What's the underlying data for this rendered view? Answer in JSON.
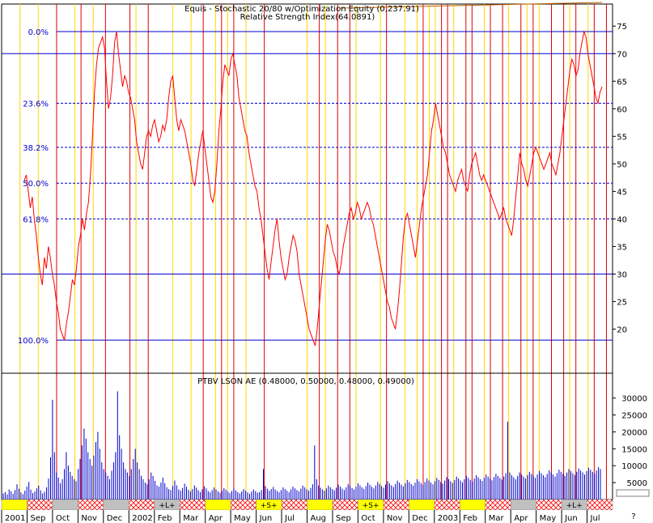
{
  "chart_data": [
    {
      "type": "line",
      "title": "Equis - Stochastic 20/80  w/Optimization Equity (0,237.91)",
      "subtitle": "Relative Strength Index(64.0891)",
      "ylim": [
        12,
        79
      ],
      "yticks": [
        20,
        25,
        30,
        35,
        40,
        45,
        50,
        55,
        60,
        65,
        70,
        75
      ],
      "hlines": [
        {
          "y": 70,
          "style": "solid"
        },
        {
          "y": 30,
          "style": "solid"
        }
      ],
      "fib_levels": [
        {
          "label": "0.0%",
          "y": 74
        },
        {
          "label": "23.6%",
          "y": 61
        },
        {
          "label": "38.2%",
          "y": 53
        },
        {
          "label": "50.0%",
          "y": 46.5
        },
        {
          "label": "61.8%",
          "y": 40
        },
        {
          "label": "100.0%",
          "y": 18
        }
      ],
      "series": [
        {
          "color": "#ff0000",
          "values": [
            47,
            48,
            45,
            42,
            44,
            40,
            37,
            33,
            30,
            28,
            33,
            31,
            35,
            33,
            30,
            28,
            25,
            23,
            20,
            19,
            18,
            21,
            23,
            26,
            29,
            28,
            31,
            35,
            37,
            40,
            38,
            41,
            43,
            48,
            55,
            63,
            68,
            71,
            72,
            73,
            71,
            65,
            60,
            62,
            66,
            72,
            74,
            70,
            67,
            64,
            66,
            65,
            63,
            62,
            60,
            58,
            54,
            52,
            50,
            49,
            52,
            55,
            56,
            55,
            57,
            58,
            56,
            54,
            55,
            57,
            56,
            58,
            62,
            65,
            66,
            62,
            58,
            56,
            58,
            57,
            56,
            54,
            52,
            50,
            47,
            46,
            49,
            52,
            54,
            56,
            53,
            50,
            47,
            44,
            43,
            45,
            50,
            56,
            60,
            65,
            68,
            67,
            66,
            69,
            70,
            68,
            66,
            62,
            60,
            58,
            56,
            55,
            52,
            50,
            48,
            46,
            45,
            42,
            40,
            37,
            34,
            31,
            29,
            32,
            35,
            38,
            40,
            36,
            33,
            31,
            29,
            30,
            33,
            35,
            37,
            36,
            34,
            30,
            28,
            26,
            24,
            22,
            20,
            19,
            18,
            17,
            20,
            24,
            28,
            32,
            36,
            39,
            38,
            36,
            34,
            33,
            31,
            30,
            32,
            35,
            37,
            39,
            41,
            42,
            40,
            41,
            43,
            42,
            40,
            41,
            42,
            43,
            42,
            40,
            39,
            37,
            35,
            33,
            31,
            29,
            27,
            25,
            24,
            22,
            21,
            20,
            23,
            27,
            32,
            37,
            40,
            41,
            39,
            37,
            35,
            33,
            36,
            39,
            42,
            44,
            46,
            48,
            52,
            56,
            58,
            61,
            59,
            57,
            55,
            53,
            52,
            50,
            48,
            47,
            46,
            45,
            47,
            48,
            49,
            47,
            46,
            45,
            48,
            50,
            51,
            52,
            50,
            48,
            47,
            48,
            47,
            46,
            45,
            44,
            43,
            42,
            41,
            40,
            41,
            42,
            40,
            39,
            38,
            37,
            40,
            44,
            48,
            52,
            50,
            49,
            47,
            46,
            48,
            50,
            52,
            53,
            52,
            51,
            50,
            49,
            50,
            51,
            52,
            50,
            49,
            48,
            50,
            52,
            55,
            58,
            61,
            64,
            67,
            69,
            68,
            66,
            67,
            70,
            72,
            74,
            73,
            70,
            68,
            66,
            64,
            62,
            61,
            63,
            64
          ]
        }
      ]
    },
    {
      "type": "bar",
      "title": "PTBV LSON AE (0.48000, 0.50000, 0.48000, 0.49000)",
      "ylim": [
        0,
        34000
      ],
      "yticks": [
        5000,
        10000,
        15000,
        20000,
        25000,
        30000
      ],
      "series": [
        {
          "color": "#0000cc",
          "values": [
            1800,
            2200,
            1500,
            3000,
            2400,
            1700,
            2800,
            4500,
            3200,
            2100,
            1600,
            2600,
            3800,
            5200,
            2900,
            1900,
            2400,
            3300,
            4100,
            2700,
            1800,
            2300,
            3600,
            6200,
            12500,
            29500,
            14000,
            8000,
            6500,
            4800,
            6000,
            9000,
            14000,
            10000,
            8200,
            7000,
            6000,
            5400,
            9000,
            12000,
            16000,
            21000,
            18000,
            14000,
            12000,
            10000,
            13000,
            17000,
            20000,
            15000,
            11000,
            9000,
            8000,
            7000,
            6000,
            8500,
            11000,
            14000,
            32000,
            19000,
            15000,
            11000,
            9000,
            8000,
            7000,
            9000,
            12000,
            15000,
            11000,
            9000,
            7000,
            6000,
            5000,
            4500,
            6000,
            8000,
            7000,
            5500,
            4200,
            3800,
            5000,
            6500,
            4800,
            3600,
            3100,
            2800,
            4000,
            5600,
            4200,
            3000,
            2600,
            3400,
            4700,
            3800,
            2900,
            2400,
            3100,
            4200,
            3500,
            2700,
            2200,
            3000,
            3900,
            3300,
            2500,
            2100,
            2800,
            3600,
            3000,
            2400,
            2000,
            2600,
            3400,
            2900,
            2300,
            1900,
            2500,
            3200,
            2700,
            2200,
            1800,
            2400,
            3100,
            2600,
            2100,
            1700,
            2300,
            3000,
            2500,
            2000,
            2200,
            2800,
            9000,
            4000,
            3200,
            2600,
            3100,
            3700,
            3000,
            2500,
            2100,
            2800,
            3600,
            3100,
            2600,
            2200,
            3000,
            3800,
            3300,
            2800,
            2400,
            3200,
            4100,
            3600,
            3000,
            2600,
            3400,
            4500,
            16000,
            6000,
            4200,
            3500,
            3000,
            2600,
            3300,
            4100,
            3600,
            3100,
            2700,
            3500,
            4400,
            3800,
            3200,
            2800,
            3600,
            4600,
            4000,
            3400,
            3000,
            3800,
            4800,
            4200,
            3600,
            3100,
            4000,
            5000,
            4400,
            3800,
            3300,
            4200,
            5200,
            4600,
            4000,
            3500,
            4400,
            5400,
            4800,
            4200,
            3700,
            4600,
            5600,
            5000,
            4400,
            3900,
            4800,
            5800,
            5200,
            4600,
            4100,
            5000,
            6000,
            5400,
            4800,
            4300,
            5200,
            6200,
            5600,
            5000,
            4500,
            5400,
            6400,
            5800,
            5200,
            4700,
            5600,
            6600,
            6000,
            5400,
            4900,
            5800,
            6800,
            6200,
            5600,
            5100,
            6000,
            7000,
            6400,
            5800,
            5300,
            6200,
            7200,
            6600,
            6000,
            5500,
            6400,
            7400,
            6800,
            6200,
            5700,
            6600,
            7600,
            7000,
            6400,
            5900,
            6800,
            7800,
            23000,
            8000,
            7200,
            6600,
            6000,
            7000,
            8000,
            7400,
            6800,
            6200,
            7200,
            8200,
            7600,
            7000,
            6400,
            7400,
            8400,
            7800,
            7200,
            6600,
            7600,
            8600,
            8000,
            7400,
            6800,
            7800,
            8800,
            8200,
            7600,
            7000,
            8000,
            9000,
            8400,
            7800,
            7200,
            8200,
            9200,
            8600,
            8000,
            7400,
            8400,
            9400,
            8800,
            8200,
            7600,
            8600,
            9600,
            9000
          ]
        }
      ]
    }
  ],
  "timeline": {
    "labels": [
      "2001",
      "Sep",
      "Oct",
      "Nov",
      "Dec",
      "2002",
      "Feb",
      "Mar",
      "Apr",
      "May",
      "Jun",
      "Jul",
      "Aug",
      "Sep",
      "Oct",
      "Nov",
      "Dec",
      "2003",
      "Feb",
      "Mar",
      "Apr",
      "May",
      "Jun",
      "Jul"
    ],
    "corner": "?"
  },
  "signals": {
    "red_lines": [
      0.09,
      0.13,
      0.17,
      0.21,
      0.24,
      0.33,
      0.36,
      0.38,
      0.43,
      0.52,
      0.55,
      0.57,
      0.63,
      0.69,
      0.72,
      0.73,
      0.76,
      0.77,
      0.8,
      0.82,
      0.85,
      0.87,
      0.9,
      0.92,
      0.94,
      0.97,
      0.99
    ],
    "yellow_lines": [
      0.03,
      0.06,
      0.12,
      0.15,
      0.22,
      0.28,
      0.31,
      0.35,
      0.37,
      0.4,
      0.5,
      0.53,
      0.58,
      0.62,
      0.66,
      0.68,
      0.7,
      0.71,
      0.74,
      0.79,
      0.83,
      0.86,
      0.88,
      0.93,
      0.96
    ]
  },
  "strip": {
    "segments": [
      {
        "kind": "yellow",
        "label": ""
      },
      {
        "kind": "hatch",
        "label": ""
      },
      {
        "kind": "grey",
        "label": ""
      },
      {
        "kind": "hatch",
        "label": ""
      },
      {
        "kind": "grey",
        "label": ""
      },
      {
        "kind": "hatch",
        "label": ""
      },
      {
        "kind": "grey",
        "label": "+L+"
      },
      {
        "kind": "hatch",
        "label": ""
      },
      {
        "kind": "yellow",
        "label": ""
      },
      {
        "kind": "hatch",
        "label": ""
      },
      {
        "kind": "yellow",
        "label": "+S+"
      },
      {
        "kind": "hatch",
        "label": ""
      },
      {
        "kind": "yellow",
        "label": ""
      },
      {
        "kind": "hatch",
        "label": ""
      },
      {
        "kind": "yellow",
        "label": "+S+"
      },
      {
        "kind": "hatch",
        "label": ""
      },
      {
        "kind": "yellow",
        "label": ""
      },
      {
        "kind": "hatch",
        "label": ""
      },
      {
        "kind": "yellow",
        "label": ""
      },
      {
        "kind": "hatch",
        "label": ""
      },
      {
        "kind": "grey",
        "label": ""
      },
      {
        "kind": "hatch",
        "label": ""
      },
      {
        "kind": "grey",
        "label": "+L+"
      },
      {
        "kind": "hatch",
        "label": ""
      }
    ]
  }
}
